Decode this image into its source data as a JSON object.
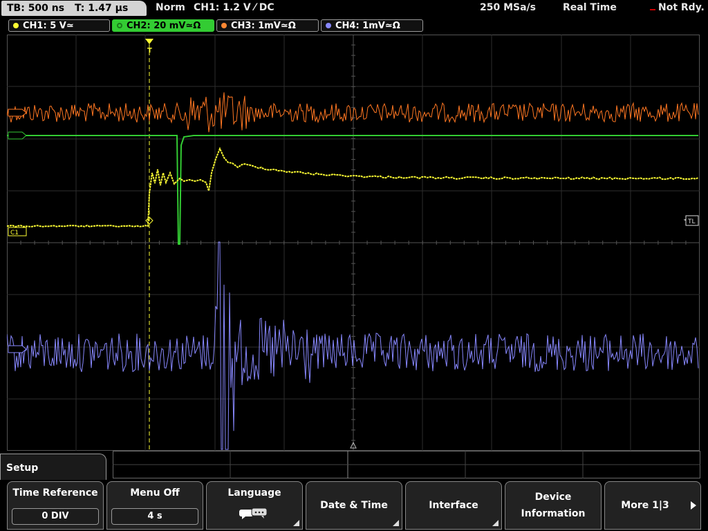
{
  "header": {
    "timebase": "TB: 500 ns",
    "trigger_time": "T: 1.47 µs",
    "trigger_mode": "Norm",
    "trigger_info": "CH1: 1.2 V ⁄ DC",
    "sample_rate": "250 MSa/s",
    "acq_mode": "Real Time",
    "trigger_status": "Not Rdy."
  },
  "channels": [
    {
      "label": "CH1: 5 V≃",
      "color": "#ffff33"
    },
    {
      "label": "CH2: 20 mV≃Ω",
      "color": "#33cc33"
    },
    {
      "label": "CH3: 1mV≃Ω",
      "color": "#ff8833"
    },
    {
      "label": "CH4: 1mV≃Ω",
      "color": "#8888ff"
    }
  ],
  "markers": {
    "c1": "C1",
    "tl": "TL",
    "trigger": "T"
  },
  "menu": {
    "title": "Setup",
    "softkeys": [
      {
        "label": "Time Reference",
        "value": "0 DIV"
      },
      {
        "label": "Menu Off",
        "value": "4 s"
      },
      {
        "label": "Language",
        "icon": "speech-bubbles-icon"
      },
      {
        "label": "Date & Time"
      },
      {
        "label": "Interface"
      },
      {
        "label_line1": "Device",
        "label_line2": "Information"
      },
      {
        "label": "More 1|3"
      }
    ]
  }
}
